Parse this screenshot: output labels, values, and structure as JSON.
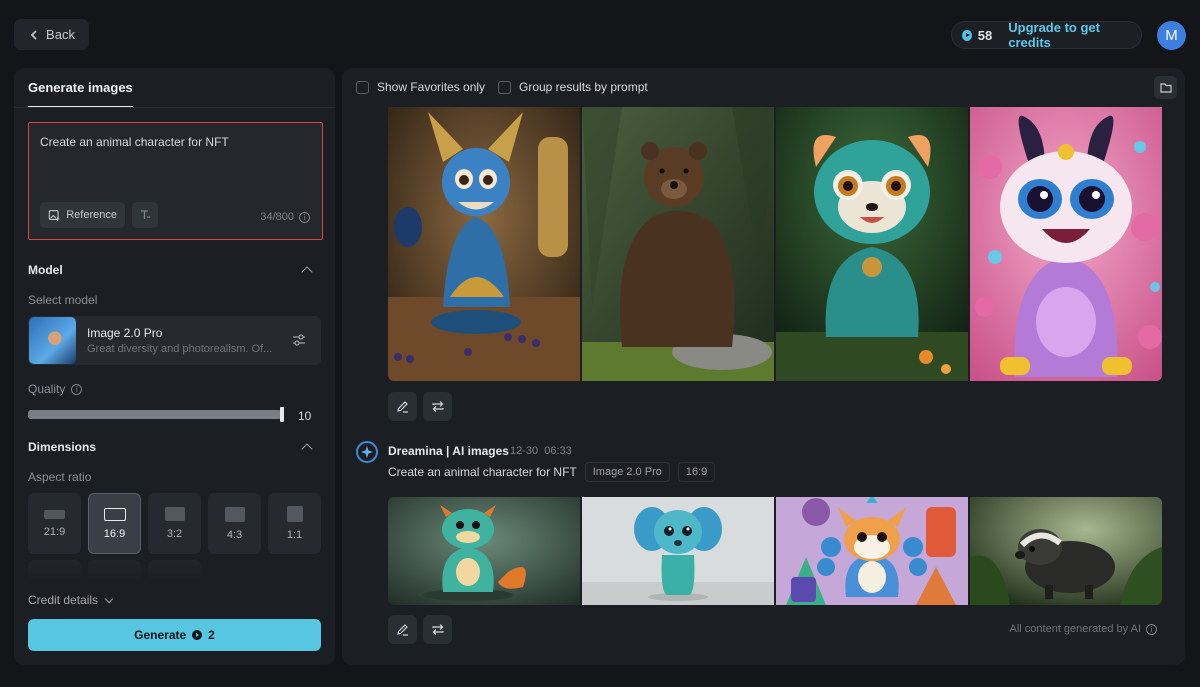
{
  "topbar": {
    "back_label": "Back",
    "credits_count": "58",
    "upgrade_label": "Upgrade to get credits",
    "avatar_initial": "M"
  },
  "left": {
    "tab_label": "Generate images",
    "prompt_text": "Create an animal character for NFT",
    "reference_label": "Reference",
    "char_count": "34/800",
    "model_section": "Model",
    "select_model_label": "Select model",
    "model_name": "Image 2.0 Pro",
    "model_desc": "Great diversity and photorealism. Of...",
    "quality_label": "Quality",
    "quality_value": "10",
    "quality_fraction": 1.0,
    "dimensions_section": "Dimensions",
    "aspect_label": "Aspect ratio",
    "aspect_ratios": [
      "21:9",
      "16:9",
      "3:2",
      "4:3",
      "1:1"
    ],
    "selected_ratio": "16:9",
    "credit_details_label": "Credit details",
    "generate_label": "Generate",
    "generate_cost": "2",
    "accent_color": "#57c6e1",
    "prompt_border_color": "#d9463b"
  },
  "right": {
    "filter_favorites": "Show Favorites only",
    "filter_group": "Group results by prompt",
    "result2": {
      "bot_name": "Dreamina | AI images",
      "date": "12-30",
      "time": "06:33",
      "prompt": "Create an animal character for NFT",
      "model_tag": "Image 2.0 Pro",
      "ratio_tag": "16:9"
    },
    "ai_note": "All content generated by AI",
    "row1_images": [
      "blue-gold-fox-creature",
      "brown-bear",
      "teal-raccoon-character",
      "pink-bunny-monster"
    ],
    "row2_images": [
      "teal-dragon-toy",
      "blue-elephant-toy",
      "peacock-cat-character",
      "badger-in-forest"
    ]
  }
}
